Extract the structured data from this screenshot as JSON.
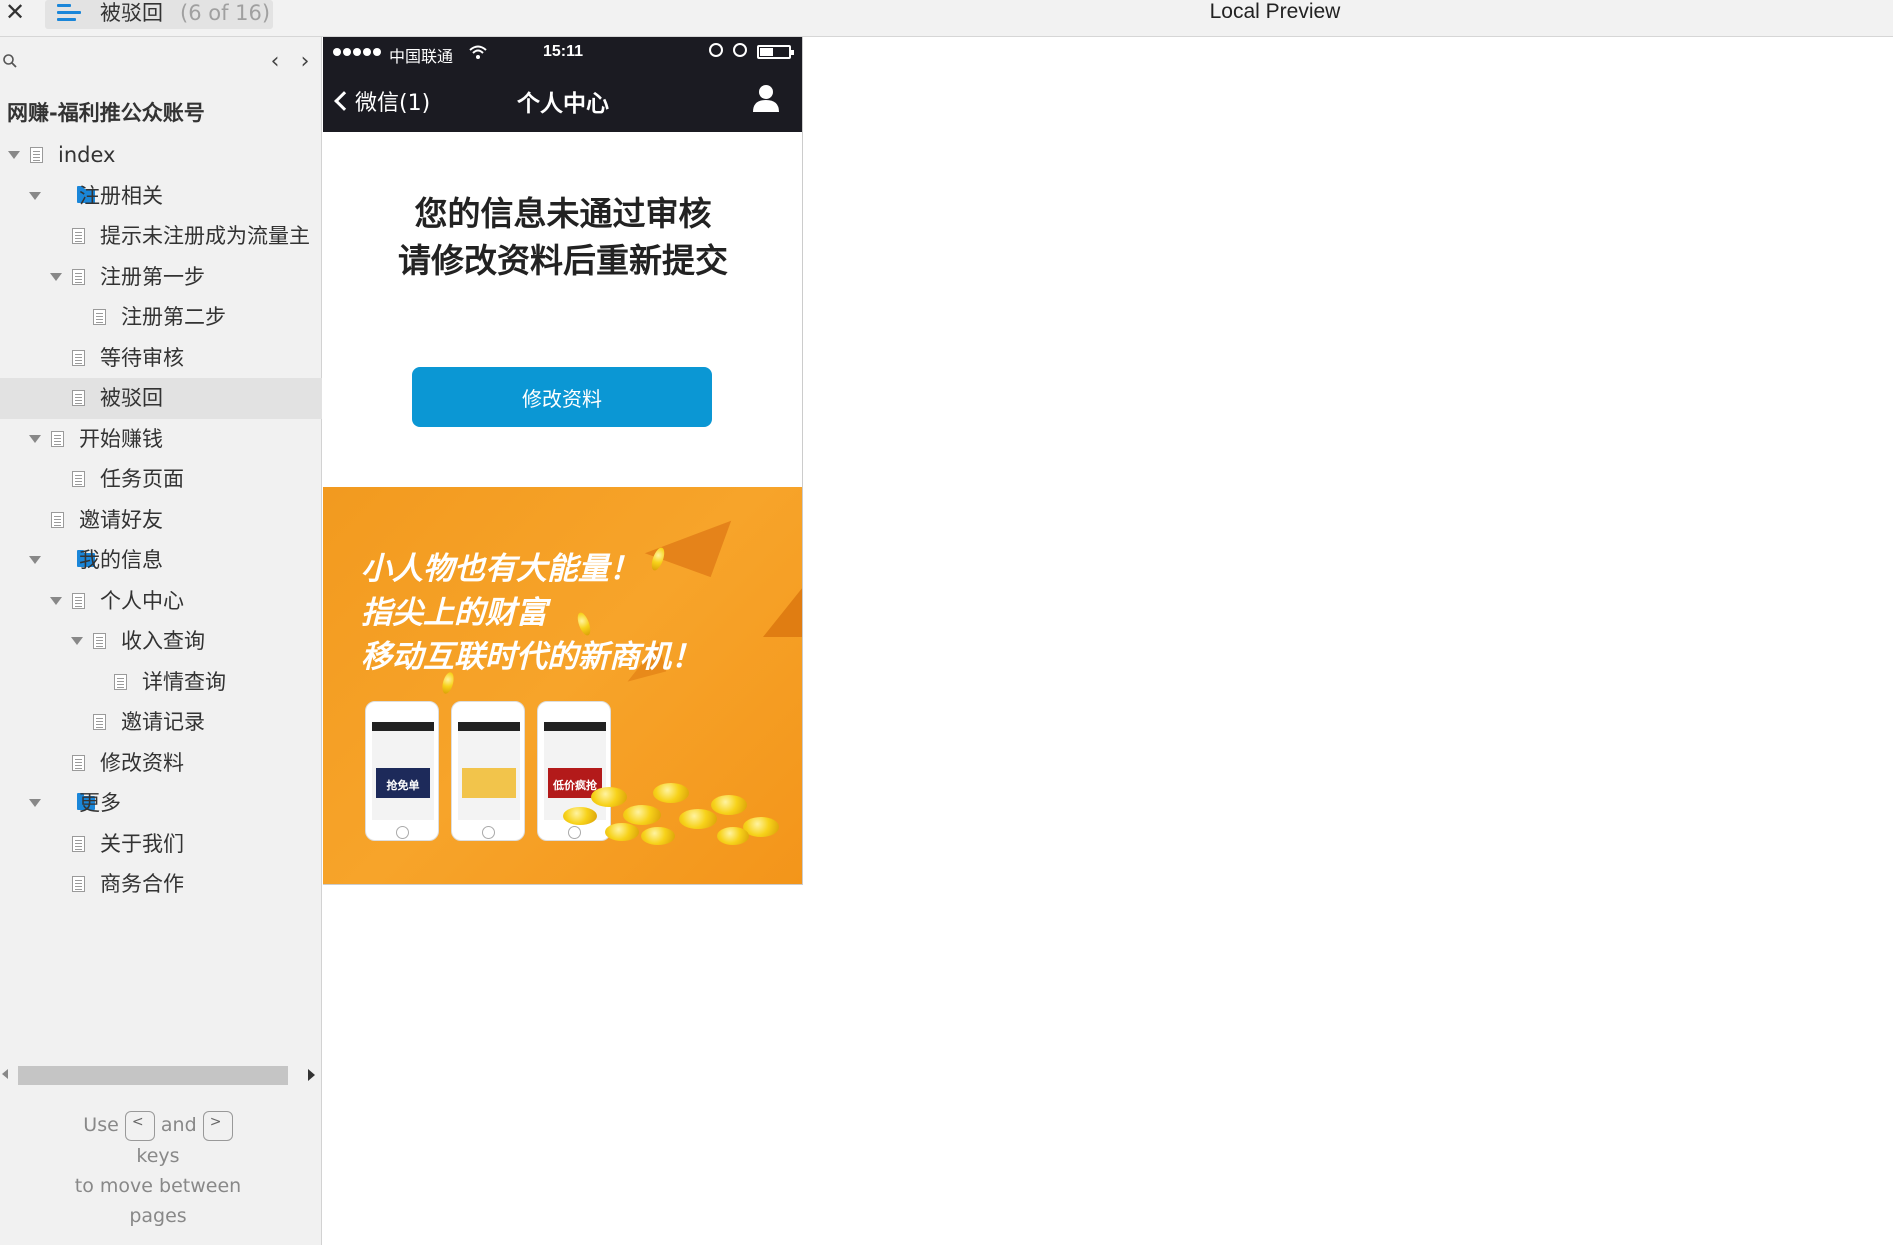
{
  "window": {
    "title": "Local Preview",
    "tab_title": "被驳回",
    "tab_count": "(6 of 16)",
    "close_glyph": "✕"
  },
  "sidebar": {
    "project_title": "网赚-福利推公众账号",
    "nav_prev": "‹",
    "nav_next": "›",
    "tree": [
      {
        "label": "index",
        "level": 0,
        "icon": "page-icon",
        "expanded": true
      },
      {
        "label": "注册相关",
        "level": 1,
        "icon": "folder-icon",
        "expanded": true
      },
      {
        "label": "提示未注册成为流量主",
        "level": 2,
        "icon": "page-icon"
      },
      {
        "label": "注册第一步",
        "level": 2,
        "icon": "page-icon",
        "expanded": true
      },
      {
        "label": "注册第二步",
        "level": 3,
        "icon": "page-icon"
      },
      {
        "label": "等待审核",
        "level": 2,
        "icon": "page-icon"
      },
      {
        "label": "被驳回",
        "level": 2,
        "icon": "page-icon",
        "selected": true
      },
      {
        "label": "开始赚钱",
        "level": 1,
        "icon": "page-icon",
        "expanded": true
      },
      {
        "label": "任务页面",
        "level": 2,
        "icon": "page-icon"
      },
      {
        "label": "邀请好友",
        "level": 1,
        "icon": "page-icon"
      },
      {
        "label": "我的信息",
        "level": 1,
        "icon": "folder-icon",
        "expanded": true
      },
      {
        "label": "个人中心",
        "level": 2,
        "icon": "page-icon",
        "expanded": true
      },
      {
        "label": "收入查询",
        "level": 3,
        "icon": "page-icon",
        "expanded": true
      },
      {
        "label": "详情查询",
        "level": 4,
        "icon": "page-icon"
      },
      {
        "label": "邀请记录",
        "level": 3,
        "icon": "page-icon"
      },
      {
        "label": "修改资料",
        "level": 2,
        "icon": "page-icon"
      },
      {
        "label": "更多",
        "level": 1,
        "icon": "folder-icon",
        "expanded": true
      },
      {
        "label": "关于我们",
        "level": 2,
        "icon": "page-icon"
      },
      {
        "label": "商务合作",
        "level": 2,
        "icon": "page-icon"
      }
    ],
    "hint": {
      "use": "Use",
      "and": "and",
      "keys": "keys",
      "line2": "to move between",
      "line3": "pages",
      "key_prev": "<",
      "key_next": ">"
    }
  },
  "phone": {
    "status": {
      "carrier": "中国联通",
      "time": "15:11",
      "battery_level": 0.45
    },
    "nav": {
      "back_label": "微信(1)",
      "title": "个人中心"
    },
    "message_line1": "您的信息未通过审核",
    "message_line2": "请修改资料后重新提交",
    "edit_button": "修改资料",
    "banner": {
      "line1": "小人物也有大能量！",
      "line2": "指尖上的财富",
      "line3": "移动互联时代的新商机！",
      "phone_tags": [
        "抢免单",
        "",
        "低价疯抢"
      ]
    }
  },
  "colors": {
    "accent_blue": "#1a86d9",
    "button_blue": "#0b97d4",
    "header_dark": "#1b1b22",
    "banner_orange": "#f29a1f"
  }
}
